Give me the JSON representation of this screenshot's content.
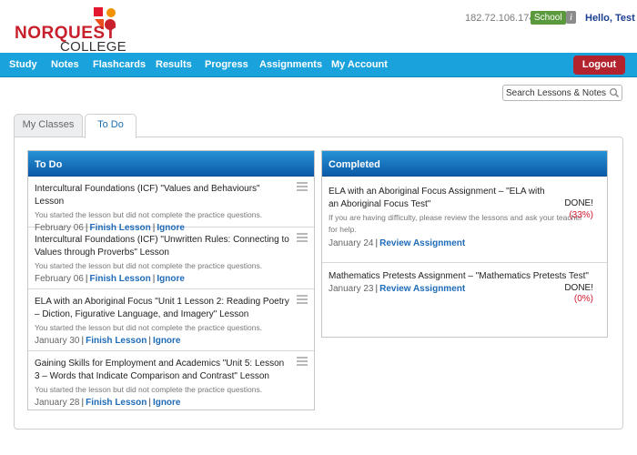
{
  "header": {
    "logo_line1": "NORQUEST",
    "logo_line2": "COLLEGE",
    "ip_address": "182.72.106.174",
    "badge": "School",
    "info_icon": "i",
    "greeting": "Hello, Test"
  },
  "nav": {
    "items": [
      "Study",
      "Notes",
      "Flashcards",
      "Results",
      "Progress",
      "Assignments",
      "My Account"
    ],
    "logout": "Logout"
  },
  "search": {
    "placeholder": "Search Lessons & Notes"
  },
  "tabs": [
    "My Classes",
    "To Do"
  ],
  "todo": {
    "heading": "To Do",
    "items": [
      {
        "title": "Intercultural Foundations (ICF) \"Values and Behaviours\" Lesson",
        "note": "You started the lesson but did not complete the practice questions.",
        "date": "February 06",
        "action": "Finish Lesson",
        "ignore": "Ignore"
      },
      {
        "title": "Intercultural Foundations (ICF) \"Unwritten Rules: Connecting to Values through Proverbs\" Lesson",
        "note": "You started the lesson but did not complete the practice questions.",
        "date": "February 06",
        "action": "Finish Lesson",
        "ignore": "Ignore"
      },
      {
        "title": "ELA with an Aboriginal Focus \"Unit 1 Lesson 2: Reading Poetry – Diction, Figurative Language, and Imagery\" Lesson",
        "note": "You started the lesson but did not complete the practice questions.",
        "date": "January 30",
        "action": "Finish Lesson",
        "ignore": "Ignore"
      },
      {
        "title": "Gaining Skills for Employment and Academics \"Unit 5: Lesson 3 – Words that Indicate Comparison and Contrast\" Lesson",
        "note": "You started the lesson but did not complete the practice questions.",
        "date": "January 28",
        "action": "Finish Lesson",
        "ignore": "Ignore"
      }
    ]
  },
  "completed": {
    "heading": "Completed",
    "items": [
      {
        "title": "ELA with an Aboriginal Focus Assignment – \"ELA with an Aboriginal Focus Test\"",
        "note": "If you are having difficulty, please review the lessons and ask your teacher for help.",
        "date": "January 24",
        "action": "Review Assignment",
        "status": "DONE!",
        "score": "(33%)"
      },
      {
        "title": "Mathematics Pretests Assignment – \"Mathematics Pretests Test\"",
        "date": "January 23",
        "action": "Review Assignment",
        "status": "DONE!",
        "score": "(0%)"
      }
    ]
  },
  "colors": {
    "brand_red": "#c8202c",
    "nav_blue": "#1aa2dd",
    "column_header_blue": "#0c5aa7",
    "link_blue": "#1e6bb8",
    "logout_red": "#b3232e",
    "score_red": "#d0182b",
    "badge_green": "#5a9a3c"
  },
  "icons": [
    "norquest-logo-mark",
    "info-icon",
    "search-icon",
    "drag-handle-icon"
  ]
}
